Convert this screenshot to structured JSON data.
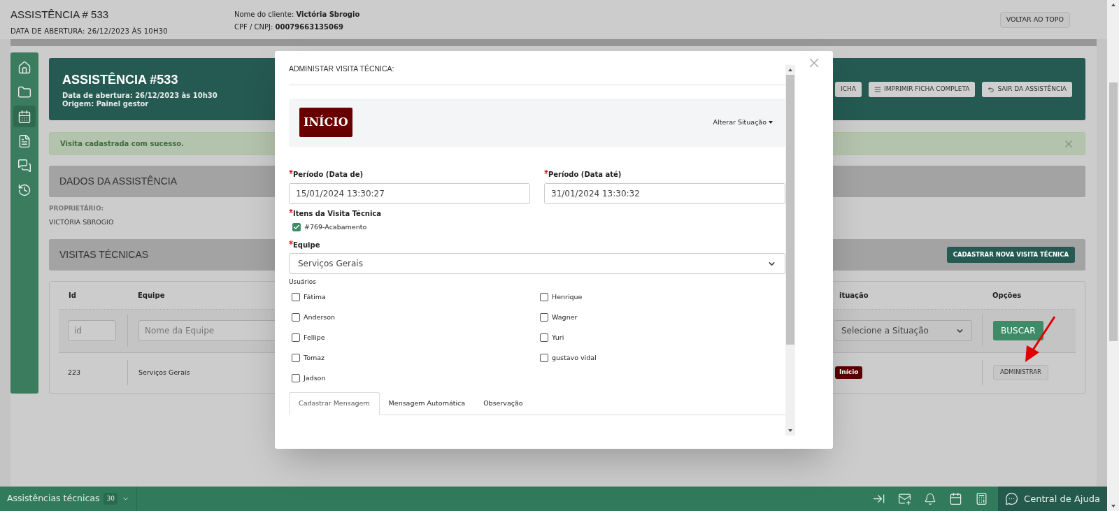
{
  "header": {
    "title": "ASSISTÊNCIA # 533",
    "opening_date": "DATA DE ABERTURA: 26/12/2023 ÀS 10H30",
    "client_label": "Nome do cliente:",
    "client_name": "Victória Sbrogio",
    "cpf_label": "CPF / CNPJ:",
    "cpf_value": "00079663135069",
    "back_to_top": "VOLTAR AO TOPO"
  },
  "sidebar": [
    {
      "kind": "home",
      "selected": false
    },
    {
      "kind": "folder",
      "selected": false
    },
    {
      "kind": "calendar",
      "selected": true
    },
    {
      "kind": "document",
      "selected": false
    },
    {
      "kind": "chat",
      "selected": false
    },
    {
      "kind": "history",
      "selected": false
    }
  ],
  "card": {
    "title": "ASSISTÊNCIA #533",
    "opening": "Data de abertura: 26/12/2023 às 10h30",
    "origin": "Origem: Painel gestor",
    "buttons": [
      {
        "kind": "plain",
        "label": "ICHA"
      },
      {
        "kind": "list",
        "label": "IMPRIMIR FICHA COMPLETA"
      },
      {
        "kind": "back",
        "label": "SAIR DA ASSISTÊNCIA"
      }
    ]
  },
  "alert": {
    "text": "Visita cadastrada com sucesso."
  },
  "data_section": {
    "title": "DADOS DA ASSISTÊNCIA",
    "owner_label": "PROPRIETÁRIO:",
    "owner_value": "VICTÓRIA SBROGIO"
  },
  "visits_section": {
    "title": "VISITAS TÉCNICAS",
    "new_button": "CADASTRAR NOVA VISITA TÉCNICA"
  },
  "table": {
    "columns": [
      "Id",
      "Equipe",
      "ituação",
      "Opções"
    ],
    "filters": {
      "id_placeholder": "id",
      "team_placeholder": "Nome da Equipe",
      "status_select": "Selecione a Situação",
      "search_button": "BUSCAR"
    },
    "rows": [
      {
        "id": "223",
        "team": "Serviços Gerais",
        "status": "Início",
        "action": "ADMINISTRAR"
      }
    ]
  },
  "modal": {
    "title": "ADMINISTAR VISITA TÉCNICA:",
    "status_badge": "INÍCIO",
    "change_status": "Alterar Situação",
    "date_fields": [
      {
        "label": "Período (Data de)",
        "required": true,
        "value": "15/01/2024 13:30:27"
      },
      {
        "label": "Período (Data até)",
        "required": true,
        "value": "31/01/2024 13:30:32"
      }
    ],
    "items_label": "Itens da Visita Técnica",
    "items_required": true,
    "items": [
      {
        "label": "#769-Acabamento",
        "checked": true
      }
    ],
    "team_label": "Equipe",
    "team_required": true,
    "team_value": "Serviços Gerais",
    "users_label": "Usuários",
    "users": [
      {
        "label": "Fátima",
        "checked": false
      },
      {
        "label": "Henrique",
        "checked": false
      },
      {
        "label": "Anderson",
        "checked": false
      },
      {
        "label": "Wagner",
        "checked": false
      },
      {
        "label": "Fellipe",
        "checked": false
      },
      {
        "label": "Yuri",
        "checked": false
      },
      {
        "label": "Tomaz",
        "checked": false
      },
      {
        "label": "gustavo vidal",
        "checked": false
      },
      {
        "label": "Jadson",
        "checked": false
      }
    ],
    "tabs": [
      {
        "label": "Cadastrar Mensagem",
        "selected": true
      },
      {
        "label": "Mensagem Automática",
        "selected": false
      },
      {
        "label": "Observação",
        "selected": false
      }
    ]
  },
  "footer": {
    "label": "Assistências técnicas",
    "count": "30",
    "help": "Central de Ajuda"
  }
}
